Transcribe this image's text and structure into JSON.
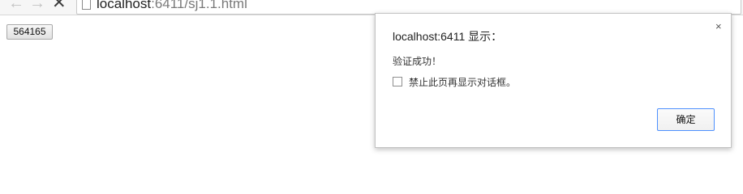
{
  "browser": {
    "nav": {
      "back_icon": "left-arrow-icon",
      "forward_icon": "right-arrow-icon",
      "close_icon": "close-icon"
    },
    "address": {
      "host": "localhost",
      "path": ":6411/sj1.1.html"
    }
  },
  "page": {
    "button_label": "564165"
  },
  "dialog": {
    "title": "localhost:6411 显示：",
    "close_icon": "close-icon",
    "close_symbol": "×",
    "message": "验证成功！",
    "suppress_label": "禁止此页再显示对话框。",
    "suppress_checked": false,
    "ok_label": "确定"
  },
  "colors": {
    "accent": "#4d90fe",
    "toolbar_bg": "#f6f6f6"
  }
}
